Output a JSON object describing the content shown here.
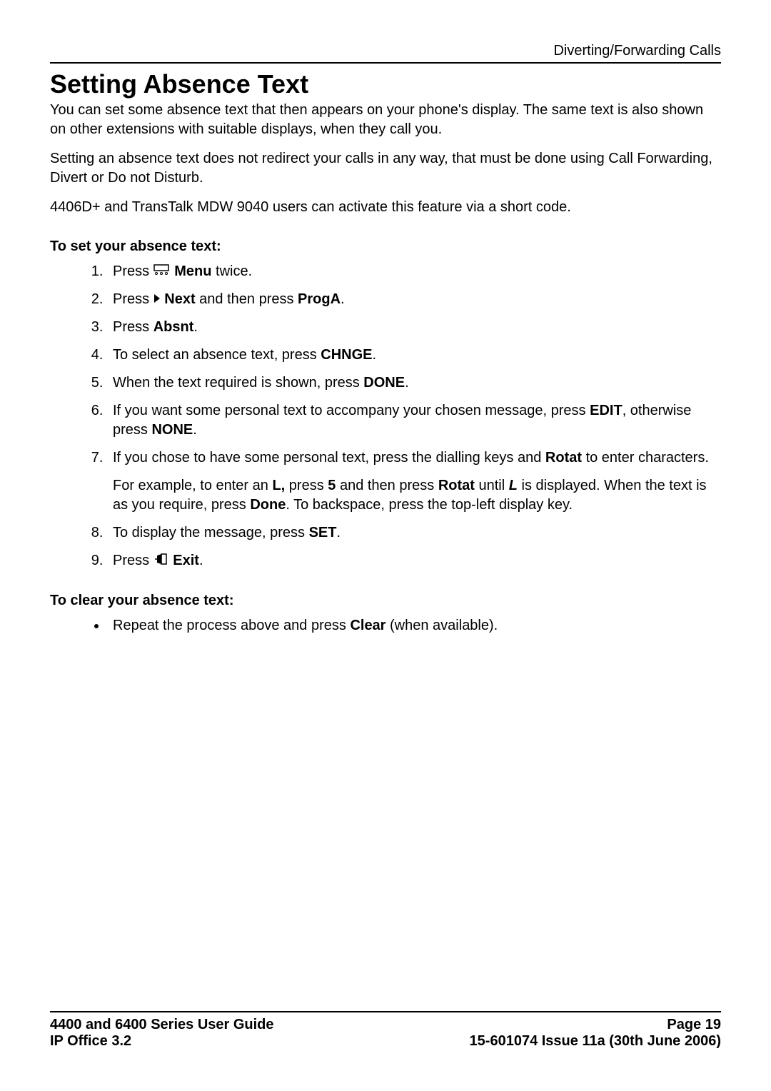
{
  "header": {
    "section": "Diverting/Forwarding Calls"
  },
  "title": "Setting Absence Text",
  "intro": {
    "p1": "You can set some absence text that then appears on your phone's display. The same text is also shown on other extensions with suitable displays, when they call you.",
    "p2": "Setting an absence text does not redirect your calls in any way, that must be done using Call Forwarding, Divert or Do not Disturb.",
    "p3": "4406D+ and TransTalk MDW 9040 users can activate this feature via a short code."
  },
  "set_heading": "To set your absence text:",
  "steps": {
    "s1_pre": "Press ",
    "s1_menu": "Menu",
    "s1_post": " twice.",
    "s2_pre": "Press ",
    "s2_next": "Next",
    "s2_mid": " and then press ",
    "s2_proga": "ProgA",
    "s2_post": ".",
    "s3_pre": "Press ",
    "s3_absnt": "Absnt",
    "s3_post": ".",
    "s4_pre": "To select an absence text, press ",
    "s4_chnge": "CHNGE",
    "s4_post": ".",
    "s5_pre": "When the text required is shown, press ",
    "s5_done": "DONE",
    "s5_post": ".",
    "s6_pre": "If you want some personal text to accompany your chosen message, press ",
    "s6_edit": "EDIT",
    "s6_mid": ", otherwise press ",
    "s6_none": "NONE",
    "s6_post": ".",
    "s7_pre": "If you chose to have some personal text, press the dialling keys and ",
    "s7_rotat": "Rotat",
    "s7_post": " to enter characters.",
    "s7b_pre": "For example, to enter an ",
    "s7b_L": "L,",
    "s7b_mid1": " press ",
    "s7b_5": "5",
    "s7b_mid2": " and then press ",
    "s7b_rotat": "Rotat",
    "s7b_mid3": " until ",
    "s7b_Li": "L",
    "s7b_mid4": " is displayed. When the text is as you require, press ",
    "s7b_done": "Done",
    "s7b_post": ". To backspace, press the top-left display key.",
    "s8_pre": "To display the message, press ",
    "s8_set": "SET",
    "s8_post": ".",
    "s9_pre": "Press ",
    "s9_exit": "Exit",
    "s9_post": "."
  },
  "clear_heading": "To clear your absence text:",
  "clear": {
    "pre": "Repeat the process above and press ",
    "clear": "Clear",
    "post": " (when available)."
  },
  "footer": {
    "left1": "4400 and 6400 Series User Guide",
    "left2": "IP Office 3.2",
    "right1": "Page 19",
    "right2": "15-601074 Issue 11a (30th June 2006)"
  }
}
